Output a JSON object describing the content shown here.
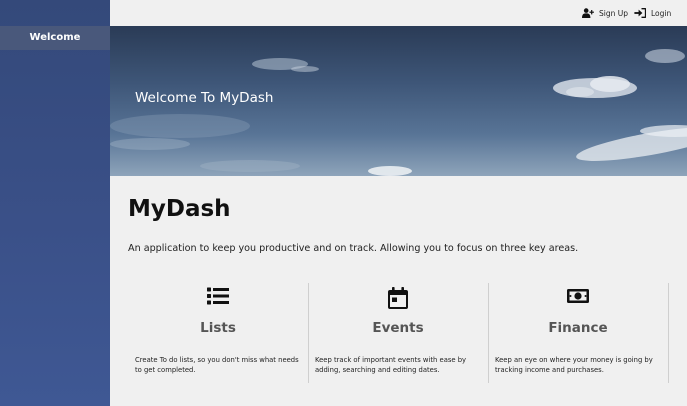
{
  "sidebar": {
    "items": [
      {
        "label": "Welcome"
      }
    ]
  },
  "topbar": {
    "signup_label": "Sign Up",
    "login_label": "Login"
  },
  "hero": {
    "title": "Welcome To MyDash"
  },
  "main": {
    "title": "MyDash",
    "tagline": "An application to keep you productive and on track. Allowing you to focus on three key areas.",
    "features": [
      {
        "icon": "list-icon",
        "title": "Lists",
        "description": "Create To do lists, so you don't miss what needs to get completed."
      },
      {
        "icon": "calendar-icon",
        "title": "Events",
        "description": "Keep track of important events with ease by adding, searching and editing dates."
      },
      {
        "icon": "money-icon",
        "title": "Finance",
        "description": "Keep an eye on where your money is going by tracking income and purchases."
      }
    ]
  }
}
